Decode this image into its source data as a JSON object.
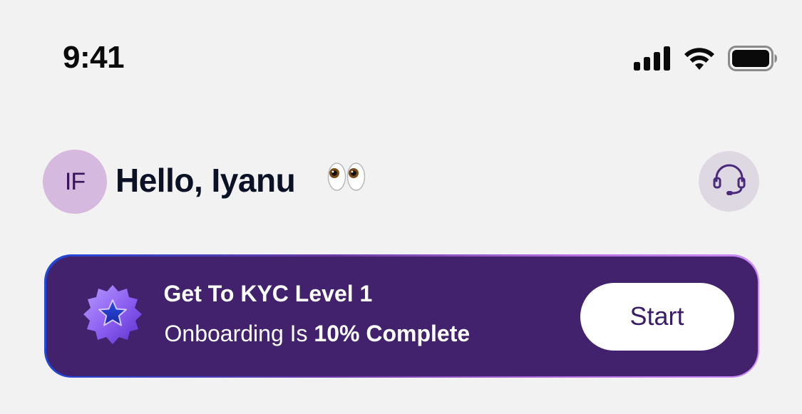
{
  "status_bar": {
    "time": "9:41",
    "icons": [
      "cellular-signal-icon",
      "wifi-icon",
      "battery-icon"
    ]
  },
  "header": {
    "avatar_initials": "IF",
    "greeting": "Hello, Iyanu",
    "greeting_emoji": "eyes-icon",
    "support_icon": "headset-icon"
  },
  "kyc_banner": {
    "badge_icon": "star-badge-icon",
    "title": "Get To KYC Level 1",
    "subtitle_prefix": "Onboarding Is ",
    "subtitle_strong": "10% Complete",
    "progress_percent": 10,
    "button_label": "Start"
  },
  "colors": {
    "background": "#f2f2f2",
    "banner_fill": "#42216d",
    "avatar_bg": "#d6b9df",
    "support_bg": "#ddd8e2",
    "button_text": "#3a1d66"
  }
}
